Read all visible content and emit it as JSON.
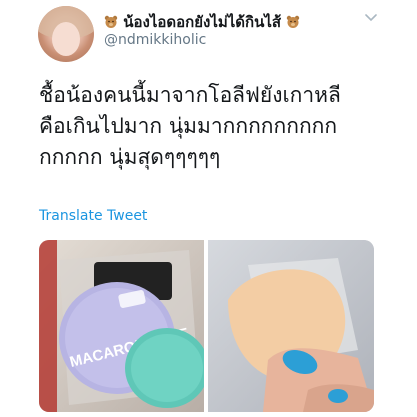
{
  "author": {
    "display_name": "น้องไอดอกยังไม่ได้กินไส้",
    "handle": "@ndmikkiholic",
    "avatar_icon": "user-avatar-photo",
    "name_emoji_icon": "teddy-bear-icon"
  },
  "tweet": {
    "lines": [
      "ชื้อน้องคนนี้มาจากโอลีฟยังเกาหลี",
      "คือเกินไปมาก นุ่มมากกกกกกกกก",
      "กกกกก นุ่มสุดๆๆๆๆๆ"
    ]
  },
  "actions": {
    "translate_label": "Translate Tweet",
    "menu_icon": "chevron-down-icon"
  },
  "media": {
    "left_photo_text": "MACARON PUFF",
    "colors": {
      "lavender_puff": "#b7b4e3",
      "mint_puff": "#5fc7b7",
      "peach_puff": "#f3cda4",
      "link_blue": "#1b95e0"
    }
  }
}
